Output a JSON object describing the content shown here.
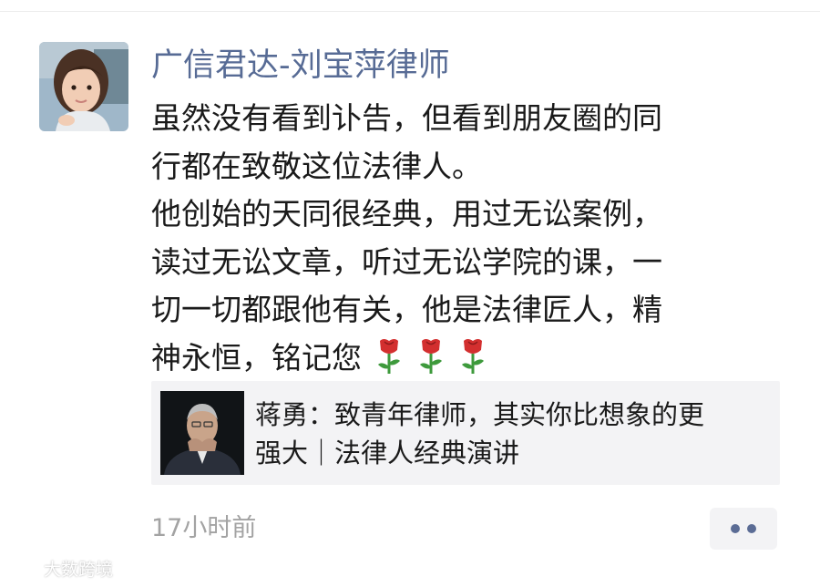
{
  "moment": {
    "author": "广信君达-刘宝萍律师",
    "text_lines": [
      "虽然没有看到讣告，但看到朋友圈的同",
      "行都在致敬这位法律人。",
      "他创始的天同很经典，用过无讼案例，",
      "读过无讼文章，听过无讼学院的课，一",
      "切一切都跟他有关，他是法律匠人，精",
      "神永恒，铭记您"
    ],
    "emoji": [
      "rose-icon",
      "rose-icon",
      "rose-icon"
    ],
    "shared_link": {
      "title_lines": [
        "蒋勇：致青年律师，其实你比想象的更",
        "强大｜法律人经典演讲"
      ]
    },
    "time": "17小时前"
  },
  "watermark": {
    "text": "大数跨境"
  },
  "colors": {
    "name": "#576b95",
    "text": "#1a1a1a",
    "muted": "#a3a3a3",
    "card_bg": "#f3f3f5",
    "rose": "#d32f2f",
    "stem": "#3e9a3c"
  }
}
